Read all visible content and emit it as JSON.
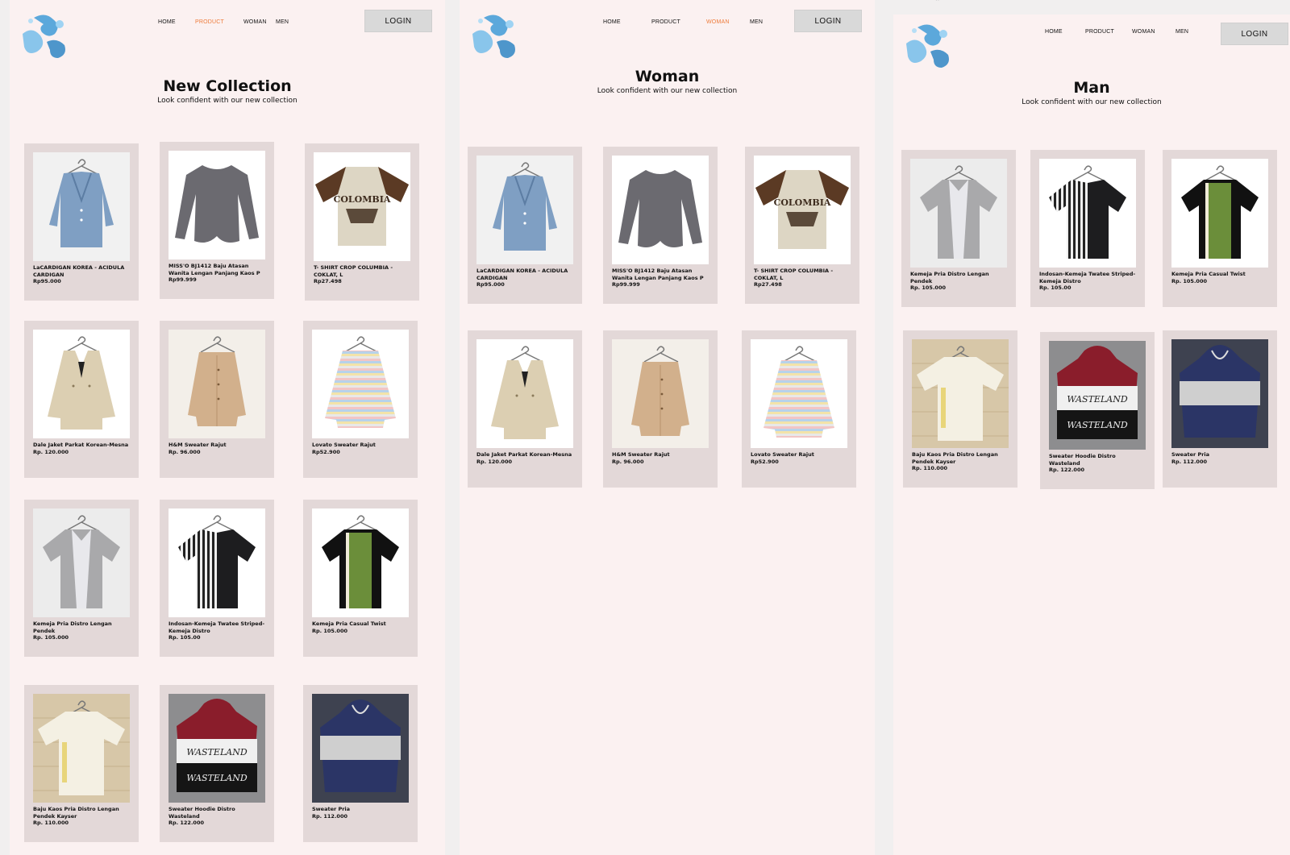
{
  "frames": [
    {
      "nav": {
        "items": [
          "HOME",
          "PRODUCT",
          "WOMAN",
          "MEN"
        ],
        "active": 1
      },
      "login_label": "LOGIN",
      "title": "New Collection",
      "subtitle": "Look confident with our new collection",
      "products": [
        {
          "name": "LaCARDIGAN KOREA - ACIDULA CARDIGAN",
          "price": "Rp95.000",
          "garment": "cardigan-blue"
        },
        {
          "name": "MISS'O BJ1412 Baju Atasan Wanita Lengan Panjang Kaos P",
          "price": "Rp99.999",
          "garment": "top-grey"
        },
        {
          "name": "T- SHIRT CROP COLUMBIA - COKLAT, L",
          "price": "Rp27.498",
          "garment": "tshirt-columbia"
        },
        {
          "name": "Dale Jaket Parkat Korean-Mesna",
          "price": "Rp. 120.000",
          "garment": "jacket-beige"
        },
        {
          "name": "H&M Sweater Rajut",
          "price": "Rp. 96.000",
          "garment": "cardigan-tan"
        },
        {
          "name": "Lovato Sweater Rajut",
          "price": "Rp52.900",
          "garment": "sweater-striped"
        },
        {
          "name": "Kemeja Pria Distro Lengan Pendek",
          "price": "Rp. 105.000",
          "garment": "shirt-grey"
        },
        {
          "name": "Indosan-Kemeja Twatee Striped-Kemeja Distro",
          "price": "Rp. 105.00",
          "garment": "shirt-striped"
        },
        {
          "name": "Kemeja Pria Casual Twist",
          "price": "Rp. 105.000",
          "garment": "shirt-green"
        },
        {
          "name": "Baju Kaos Pria Distro Lengan Pendek Kayser",
          "price": "Rp. 110.000",
          "garment": "tee-cream"
        },
        {
          "name": "Sweater Hoodie Distro Wasteland",
          "price": "Rp. 122.000",
          "garment": "hoodie-wasteland"
        },
        {
          "name": "Sweater Pria",
          "price": "Rp. 112.000",
          "garment": "hoodie-navy"
        }
      ]
    },
    {
      "nav": {
        "items": [
          "HOME",
          "PRODUCT",
          "WOMAN",
          "MEN"
        ],
        "active": 2
      },
      "login_label": "LOGIN",
      "title": "Woman",
      "subtitle": "Look confident with our new collection",
      "products": [
        {
          "name": "LaCARDIGAN KOREA - ACIDULA CARDIGAN",
          "price": "Rp95.000",
          "garment": "cardigan-blue"
        },
        {
          "name": "MISS'O BJ1412 Baju Atasan Wanita Lengan Panjang Kaos P",
          "price": "Rp99.999",
          "garment": "top-grey"
        },
        {
          "name": "T- SHIRT CROP COLUMBIA - COKLAT, L",
          "price": "Rp27.498",
          "garment": "tshirt-columbia"
        },
        {
          "name": "Dale Jaket Parkat Korean-Mesna",
          "price": "Rp. 120.000",
          "garment": "jacket-beige"
        },
        {
          "name": "H&M Sweater Rajut",
          "price": "Rp. 96.000",
          "garment": "cardigan-tan"
        },
        {
          "name": "Lovato Sweater Rajut",
          "price": "Rp52.900",
          "garment": "sweater-striped"
        }
      ]
    },
    {
      "nav": {
        "items": [
          "HOME",
          "PRODUCT",
          "WOMAN",
          "MEN"
        ],
        "active": -1
      },
      "login_label": "LOGIN",
      "title": "Man",
      "subtitle": "Look confident with our new collection",
      "products": [
        {
          "name": "Kemeja Pria Distro Lengan Pendek",
          "price": "Rp. 105.000",
          "garment": "shirt-grey"
        },
        {
          "name": "Indosan-Kemeja Twatee Striped-Kemeja Distro",
          "price": "Rp. 105.00",
          "garment": "shirt-striped"
        },
        {
          "name": "Kemeja Pria Casual Twist",
          "price": "Rp. 105.000",
          "garment": "shirt-green"
        },
        {
          "name": "Baju Kaos Pria Distro Lengan Pendek Kayser",
          "price": "Rp. 110.000",
          "garment": "tee-cream"
        },
        {
          "name": "Sweater Hoodie Distro Wasteland",
          "price": "Rp. 122.000",
          "garment": "hoodie-wasteland"
        },
        {
          "name": "Sweater Pria",
          "price": "Rp. 112.000",
          "garment": "hoodie-navy"
        }
      ]
    }
  ],
  "colors": {
    "frame_bg": "#fbf1f1",
    "card_bg": "#e3d8d8",
    "nav_active": "#ee7b3a",
    "login_bg": "#d9d9d9"
  }
}
